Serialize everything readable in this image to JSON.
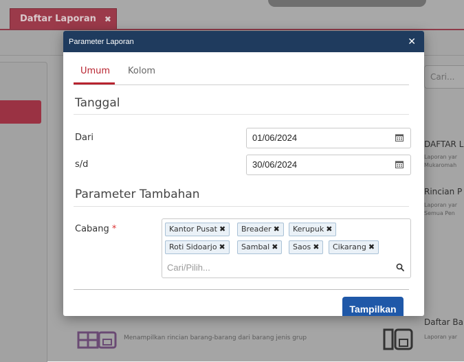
{
  "app": {
    "tab_label": "Daftar Laporan",
    "tab_close_icon": "✖",
    "search_placeholder": "Cari...",
    "right_items": [
      {
        "title": "DAFTAR L",
        "sub1": "Laporan yar",
        "sub2": "Mukaromah"
      },
      {
        "title": "Rincian P",
        "sub1": "Laporan yar",
        "sub2": "Semua Pen"
      },
      {
        "title": "Daftar Ba",
        "sub1": "Laporan yar",
        "sub2": ""
      }
    ],
    "bottom_desc": "Menampilkan rincian barang-barang dari barang jenis grup"
  },
  "modal": {
    "title": "Parameter Laporan",
    "close_icon": "✕",
    "tabs": [
      {
        "label": "Umum",
        "active": true
      },
      {
        "label": "Kolom",
        "active": false
      }
    ],
    "section_tanggal": "Tanggal",
    "dari_label": "Dari",
    "dari_value": "01/06/2024",
    "sd_label": "s/d",
    "sd_value": "30/06/2024",
    "section_tambahan": "Parameter Tambahan",
    "cabang_label": "Cabang",
    "required_mark": "*",
    "cabang_tags": [
      "Kantor Pusat",
      "Breader",
      "Kerupuk",
      "Roti Sidoarjo",
      "Sambal",
      "Saos",
      "Cikarang"
    ],
    "tag_remove_icon": "✖",
    "cabang_placeholder": "Cari/Pilih...",
    "submit_label": "Tampilkan"
  },
  "colors": {
    "header": "#1f3b5e",
    "accent": "#b8232f",
    "primary_button": "#1f58a8",
    "tag_bg": "#eaf1f7"
  }
}
